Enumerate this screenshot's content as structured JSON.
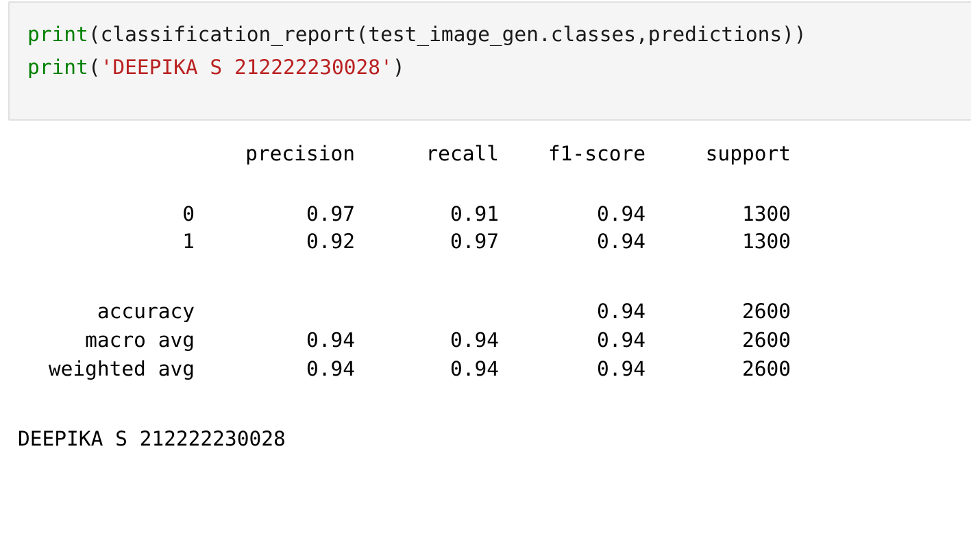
{
  "input_cell": {
    "line1": {
      "fn": "print",
      "rest": "(classification_report(test_image_gen.classes,predictions))"
    },
    "line2": {
      "fn": "print",
      "open": "(",
      "string": "'DEEPIKA S 212222230028'",
      "close": ")"
    }
  },
  "output": {
    "headers": {
      "precision": "precision",
      "recall": "recall",
      "f1": "f1-score",
      "support": "support"
    },
    "rows": [
      {
        "label": "0",
        "precision": "0.97",
        "recall": "0.91",
        "f1": "0.94",
        "support": "1300"
      },
      {
        "label": "1",
        "precision": "0.92",
        "recall": "0.97",
        "f1": "0.94",
        "support": "1300"
      },
      {
        "label": "accuracy",
        "precision": "",
        "recall": "",
        "f1": "0.94",
        "support": "2600"
      },
      {
        "label": "macro avg",
        "precision": "0.94",
        "recall": "0.94",
        "f1": "0.94",
        "support": "2600"
      },
      {
        "label": "weighted avg",
        "precision": "0.94",
        "recall": "0.94",
        "f1": "0.94",
        "support": "2600"
      }
    ],
    "footer": "DEEPIKA S 212222230028"
  },
  "colors": {
    "keyword": "#008000",
    "string": "#ba2121",
    "cell_background": "#f5f5f5",
    "cell_border": "#e0e0e0"
  }
}
